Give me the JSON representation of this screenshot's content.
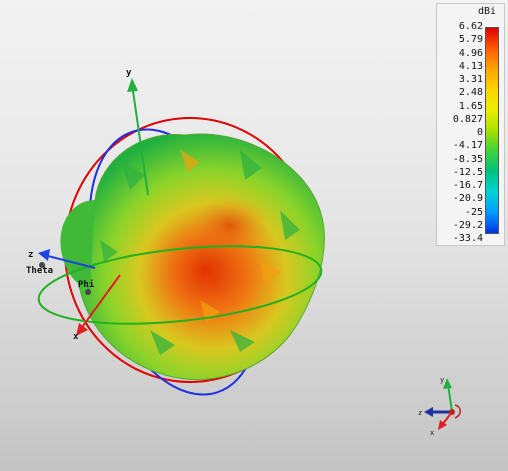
{
  "legend": {
    "unit": "dBi",
    "ticks": [
      "6.62",
      "5.79",
      "4.96",
      "4.13",
      "3.31",
      "2.48",
      "1.65",
      "0.827",
      "0",
      "-4.17",
      "-8.35",
      "-12.5",
      "-16.7",
      "-20.9",
      "-25",
      "-29.2",
      "-33.4"
    ]
  },
  "axes": {
    "main": {
      "x": "x",
      "y": "y",
      "z": "z",
      "theta": "Theta",
      "phi": "Phi"
    },
    "triad": {
      "x": "x",
      "y": "y",
      "z": "z"
    }
  },
  "colors": {
    "x_axis": "#e02020",
    "y_axis": "#20b040",
    "z_axis": "#2040e0",
    "theta_ring": "#e00000",
    "phi_ring": "#20b020",
    "plane_ring": "#2030e0"
  }
}
